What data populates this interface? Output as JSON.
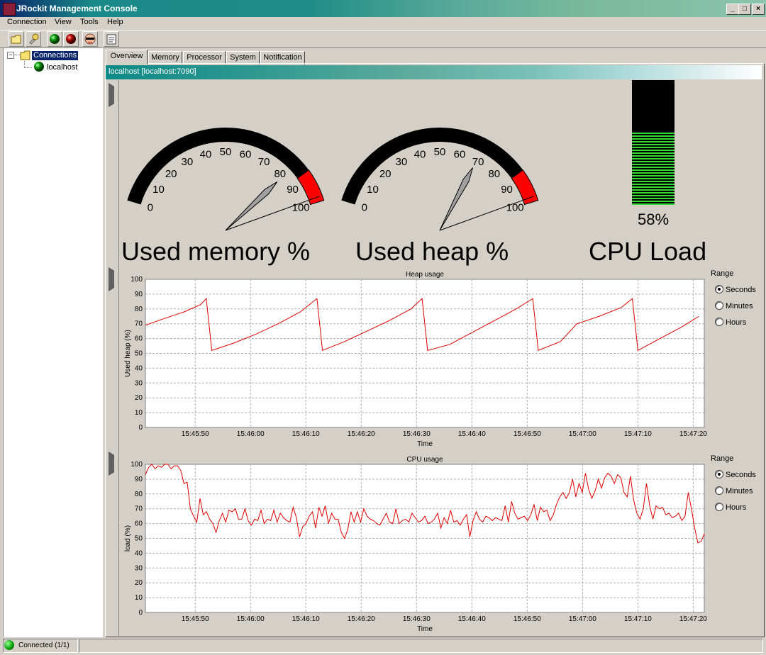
{
  "window": {
    "title": "JRockit Management Console",
    "minimize": "_",
    "maximize": "□",
    "close": "×"
  },
  "menu": [
    "Connection",
    "View",
    "Tools",
    "Help"
  ],
  "toolbar": [
    {
      "icon": "new-folder-icon"
    },
    {
      "icon": "connect-plug-icon"
    },
    {
      "icon": "start-green-icon"
    },
    {
      "icon": "stop-red-icon"
    },
    {
      "icon": "agent-icon"
    },
    {
      "icon": "properties-icon"
    }
  ],
  "tree": {
    "root": "Connections",
    "child": "localhost"
  },
  "tabs": [
    "Overview",
    "Memory",
    "Processor",
    "System",
    "Notification"
  ],
  "connection_label": "localhost [localhost:7090]",
  "gauges": {
    "memory": {
      "label": "Used memory %",
      "value": 82,
      "ticks": [
        "0",
        "10",
        "20",
        "30",
        "40",
        "50",
        "60",
        "70",
        "80",
        "90",
        "100"
      ]
    },
    "heap": {
      "label": "Used heap %",
      "value": 69,
      "ticks": [
        "0",
        "10",
        "20",
        "30",
        "40",
        "50",
        "60",
        "70",
        "80",
        "90",
        "100"
      ]
    },
    "cpu": {
      "label": "CPU Load",
      "value_text": "58%",
      "value": 58
    }
  },
  "range": {
    "title": "Range",
    "options": [
      "Seconds",
      "Minutes",
      "Hours"
    ],
    "selected": "Seconds"
  },
  "colors": {
    "series": "#e00000",
    "gauge_red": "#ff0000",
    "cpu_bar": "#33dd33"
  },
  "chart_data": [
    {
      "type": "line",
      "title": "Heap usage",
      "xlabel": "Time",
      "ylabel": "Used heap (%)",
      "ylim": [
        0,
        100
      ],
      "yticks": [
        "0",
        "10",
        "20",
        "30",
        "40",
        "50",
        "60",
        "70",
        "80",
        "90",
        "100"
      ],
      "xticks": [
        "15:45:50",
        "15:46:00",
        "15:46:10",
        "15:46:20",
        "15:46:30",
        "15:46:40",
        "15:46:50",
        "15:47:00",
        "15:47:10",
        "15:47:20"
      ],
      "grid": true,
      "series": [
        {
          "values_at_seconds": true,
          "x": [
            "15:45:41",
            "15:45:44",
            "15:45:48",
            "15:45:51",
            "15:45:52",
            "15:45:53",
            "15:45:57",
            "15:46:01",
            "15:46:05",
            "15:46:09",
            "15:46:12",
            "15:46:13",
            "15:46:17",
            "15:46:21",
            "15:46:25",
            "15:46:29",
            "15:46:31",
            "15:46:32",
            "15:46:36",
            "15:46:40",
            "15:46:44",
            "15:46:48",
            "15:46:51",
            "15:46:52",
            "15:46:56",
            "15:46:59",
            "15:47:03",
            "15:47:07",
            "15:47:09",
            "15:47:10",
            "15:47:14",
            "15:47:18",
            "15:47:21"
          ],
          "values": [
            69,
            73,
            78,
            83,
            87,
            52,
            57,
            63,
            70,
            78,
            87,
            52,
            58,
            65,
            72,
            80,
            87,
            52,
            56,
            64,
            72,
            80,
            87,
            52,
            58,
            70,
            75,
            81,
            87,
            52,
            60,
            68,
            75
          ]
        }
      ]
    },
    {
      "type": "line",
      "title": "CPU usage",
      "xlabel": "Time",
      "ylabel": "load (%)",
      "ylim": [
        0,
        100
      ],
      "yticks": [
        "0",
        "10",
        "20",
        "30",
        "40",
        "50",
        "60",
        "70",
        "80",
        "90",
        "100"
      ],
      "xticks": [
        "15:45:50",
        "15:46:00",
        "15:46:10",
        "15:46:20",
        "15:46:30",
        "15:46:40",
        "15:46:50",
        "15:47:00",
        "15:47:10",
        "15:47:20"
      ],
      "grid": true,
      "series": [
        {
          "x_seconds_from_start": true,
          "values": [
            93,
            98,
            100,
            97,
            99,
            98,
            100,
            100,
            97,
            99,
            99,
            96,
            87,
            88,
            70,
            65,
            61,
            77,
            66,
            68,
            63,
            60,
            54,
            62,
            67,
            61,
            69,
            68,
            70,
            63,
            63,
            70,
            62,
            59,
            63,
            62,
            69,
            60,
            63,
            62,
            69,
            61,
            67,
            64,
            62,
            61,
            71,
            64,
            51,
            58,
            60,
            65,
            68,
            57,
            71,
            65,
            72,
            60,
            67,
            63,
            63,
            54,
            50,
            56,
            68,
            61,
            68,
            61,
            70,
            65,
            63,
            62,
            60,
            59,
            63,
            67,
            61,
            60,
            70,
            60,
            62,
            63,
            61,
            67,
            64,
            61,
            62,
            65,
            60,
            61,
            63,
            67,
            57,
            64,
            60,
            69,
            61,
            62,
            59,
            63,
            66,
            51,
            62,
            68,
            63,
            61,
            65,
            64,
            62,
            64,
            63,
            62,
            72,
            61,
            75,
            67,
            63,
            64,
            65,
            62,
            66,
            73,
            62,
            71,
            68,
            69,
            62,
            66,
            73,
            78,
            81,
            77,
            81,
            90,
            78,
            87,
            81,
            94,
            83,
            77,
            82,
            90,
            84,
            91,
            94,
            92,
            87,
            93,
            91,
            81,
            78,
            92,
            76,
            67,
            63,
            70,
            87,
            72,
            63,
            72,
            70,
            71,
            66,
            67,
            64,
            65,
            67,
            62,
            65,
            81,
            70,
            57,
            47,
            48,
            53
          ]
        }
      ]
    }
  ],
  "status": {
    "text": "Connected (1/1)"
  }
}
